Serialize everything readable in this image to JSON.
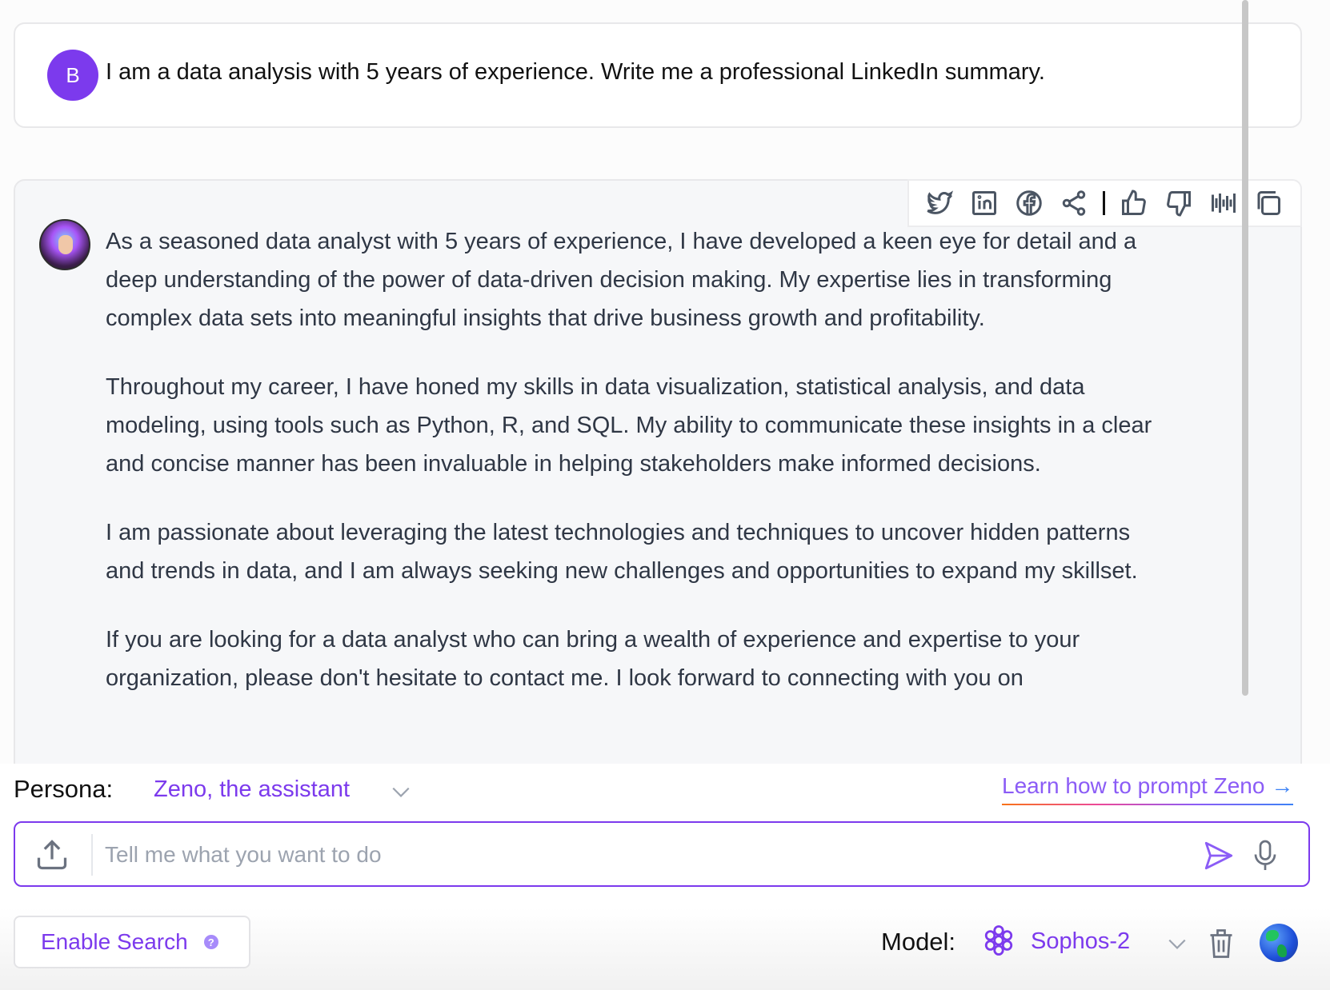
{
  "user_message": {
    "avatar_initial": "B",
    "text": "I am a data analysis with 5 years of experience. Write me a professional LinkedIn summary."
  },
  "assistant_message": {
    "paragraphs": [
      "As a seasoned data analyst with 5 years of experience, I have developed a keen eye for detail and a deep understanding of the power of data-driven decision making. My expertise lies in transforming complex data sets into meaningful insights that drive business growth and profitability.",
      "Throughout my career, I have honed my skills in data visualization, statistical analysis, and data modeling, using tools such as Python, R, and SQL. My ability to communicate these insights in a clear and concise manner has been invaluable in helping stakeholders make informed decisions.",
      "I am passionate about leveraging the latest technologies and techniques to uncover hidden patterns and trends in data, and I am always seeking new challenges and opportunities to expand my skillset.",
      "If you are looking for a data analyst who can bring a wealth of experience and expertise to your organization, please don't hesitate to contact me. I look forward to connecting with you on"
    ],
    "toolbar_icons": [
      "twitter-icon",
      "linkedin-icon",
      "facebook-icon",
      "share-icon",
      "thumbs-up-icon",
      "thumbs-down-icon",
      "audio-waveform-icon",
      "copy-icon"
    ]
  },
  "persona": {
    "label": "Persona:",
    "value": "Zeno, the assistant"
  },
  "learn_link": {
    "text": "Learn how to prompt Zeno",
    "arrow": "→"
  },
  "input": {
    "placeholder": "Tell me what you want to do",
    "value": ""
  },
  "bottom": {
    "enable_search_label": "Enable Search",
    "help_glyph": "?",
    "model_label": "Model:",
    "model_value": "Sophos-2"
  },
  "colors": {
    "accent": "#7c3aed",
    "user_avatar": "#7c3aed",
    "body_text": "#2f3745"
  }
}
